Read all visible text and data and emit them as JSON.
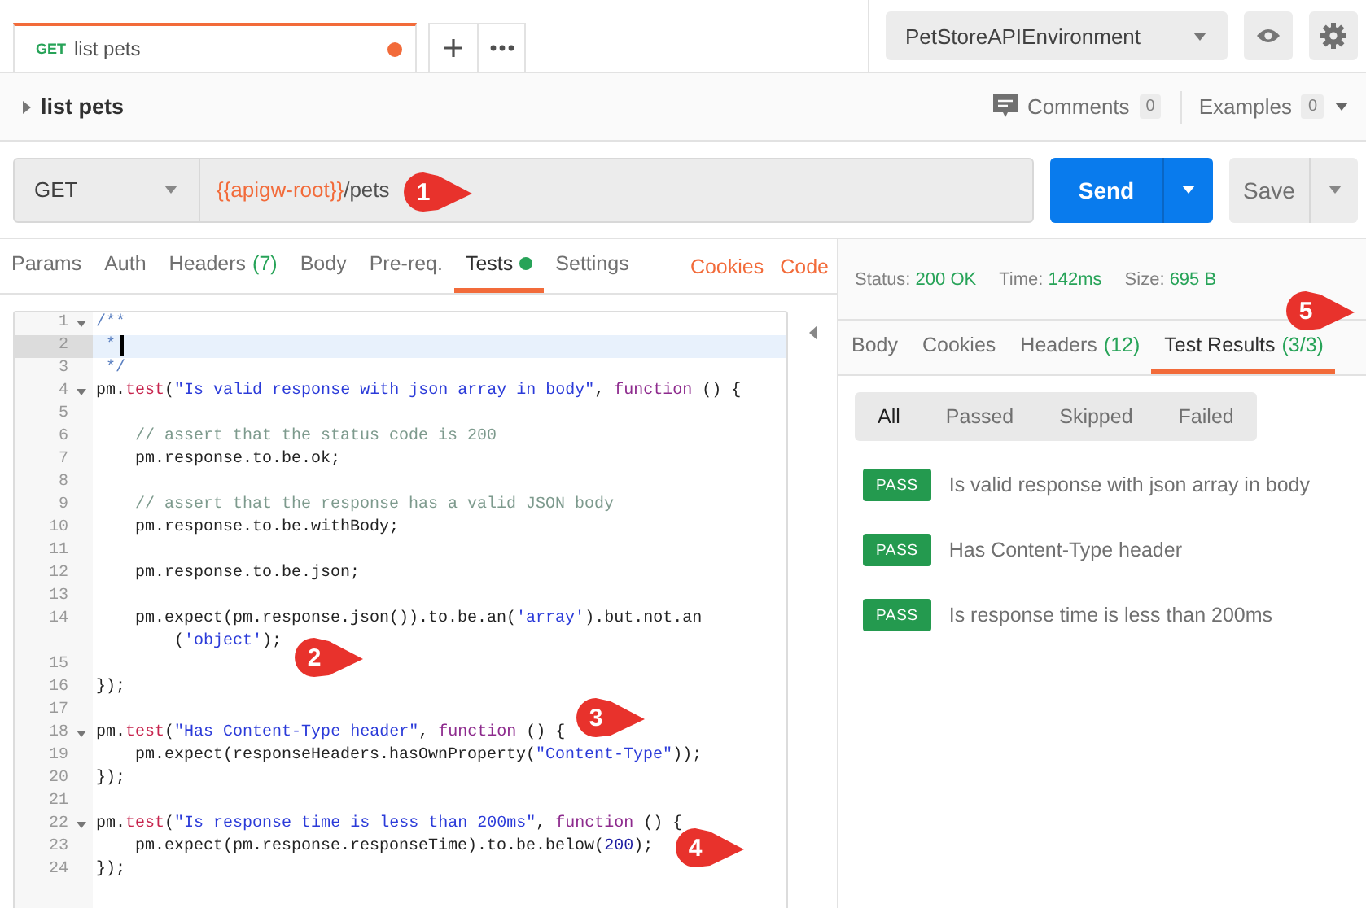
{
  "tab_bar": {
    "tabs": [
      {
        "method": "GET",
        "title": "list pets",
        "unsaved": true,
        "selected": true
      }
    ]
  },
  "environment": {
    "selected": "PetStoreAPIEnvironment"
  },
  "request_header": {
    "name": "list pets",
    "comments_label": "Comments",
    "comments_count": "0",
    "examples_label": "Examples",
    "examples_count": "0"
  },
  "url_bar": {
    "method": "GET",
    "url_variable": "{{apigw-root}}",
    "url_path": "/pets",
    "send": "Send",
    "save": "Save"
  },
  "request_tabs": [
    {
      "label": "Params",
      "selected": false,
      "dot": false
    },
    {
      "label": "Auth",
      "selected": false,
      "dot": false
    },
    {
      "label": "Headers",
      "count": "(7)",
      "selected": false,
      "dot": false
    },
    {
      "label": "Body",
      "selected": false,
      "dot": false
    },
    {
      "label": "Pre-req.",
      "selected": false,
      "dot": false
    },
    {
      "label": "Tests",
      "selected": true,
      "dot": true
    },
    {
      "label": "Settings",
      "selected": false,
      "dot": false
    }
  ],
  "request_links": [
    "Cookies",
    "Code"
  ],
  "editor": {
    "lines": [
      {
        "number": "1",
        "foldable": true,
        "active": false,
        "tokens": [
          {
            "kind": "doc",
            "text": "/**"
          }
        ]
      },
      {
        "number": "2",
        "foldable": false,
        "active": true,
        "tokens": [
          {
            "kind": "doc",
            "text": " *"
          }
        ]
      },
      {
        "number": "3",
        "foldable": false,
        "active": false,
        "tokens": [
          {
            "kind": "doc",
            "text": " */"
          }
        ]
      },
      {
        "number": "4",
        "foldable": true,
        "active": false,
        "tokens": [
          {
            "kind": "plain",
            "text": "pm."
          },
          {
            "kind": "method",
            "text": "test"
          },
          {
            "kind": "plain",
            "text": "("
          },
          {
            "kind": "string",
            "text": "\"Is valid response with json array in body\""
          },
          {
            "kind": "plain",
            "text": ", "
          },
          {
            "kind": "keyword",
            "text": "function"
          },
          {
            "kind": "plain",
            "text": " () {"
          }
        ]
      },
      {
        "number": "5",
        "foldable": false,
        "active": false
      },
      {
        "number": "6",
        "foldable": false,
        "active": false,
        "tokens": [
          {
            "kind": "comment",
            "text": "    // assert that the status code is 200"
          }
        ]
      },
      {
        "number": "7",
        "foldable": false,
        "active": false,
        "tokens": [
          {
            "kind": "plain",
            "text": "    pm.response.to.be.ok;"
          }
        ]
      },
      {
        "number": "8",
        "foldable": false,
        "active": false
      },
      {
        "number": "9",
        "foldable": false,
        "active": false,
        "tokens": [
          {
            "kind": "comment",
            "text": "    // assert that the response has a valid JSON body"
          }
        ]
      },
      {
        "number": "10",
        "foldable": false,
        "active": false,
        "tokens": [
          {
            "kind": "plain",
            "text": "    pm.response.to.be.withBody;"
          }
        ]
      },
      {
        "number": "11",
        "foldable": false,
        "active": false
      },
      {
        "number": "12",
        "foldable": false,
        "active": false,
        "tokens": [
          {
            "kind": "plain",
            "text": "    pm.response.to.be.json;"
          }
        ]
      },
      {
        "number": "13",
        "foldable": false,
        "active": false
      },
      {
        "number": "14",
        "foldable": false,
        "active": false,
        "tokens": [
          {
            "kind": "plain",
            "text": "    pm.expect(pm.response.json()).to.be.an("
          },
          {
            "kind": "string",
            "text": "'array'"
          },
          {
            "kind": "plain",
            "text": ").but.not.an"
          },
          {
            "kind": "wrap"
          },
          {
            "kind": "plain",
            "text": "("
          },
          {
            "kind": "string",
            "text": "'object'"
          },
          {
            "kind": "plain",
            "text": ");"
          }
        ]
      },
      {
        "number": "15",
        "foldable": false,
        "active": false
      },
      {
        "number": "16",
        "foldable": false,
        "active": false,
        "tokens": [
          {
            "kind": "plain",
            "text": "});"
          }
        ]
      },
      {
        "number": "17",
        "foldable": false,
        "active": false
      },
      {
        "number": "18",
        "foldable": true,
        "active": false,
        "tokens": [
          {
            "kind": "plain",
            "text": "pm."
          },
          {
            "kind": "method",
            "text": "test"
          },
          {
            "kind": "plain",
            "text": "("
          },
          {
            "kind": "string",
            "text": "\"Has Content-Type header\""
          },
          {
            "kind": "plain",
            "text": ", "
          },
          {
            "kind": "keyword",
            "text": "function"
          },
          {
            "kind": "plain",
            "text": " () {"
          }
        ]
      },
      {
        "number": "19",
        "foldable": false,
        "active": false,
        "tokens": [
          {
            "kind": "plain",
            "text": "    pm.expect(responseHeaders.hasOwnProperty("
          },
          {
            "kind": "string",
            "text": "\"Content-Type\""
          },
          {
            "kind": "plain",
            "text": "));"
          }
        ]
      },
      {
        "number": "20",
        "foldable": false,
        "active": false,
        "tokens": [
          {
            "kind": "plain",
            "text": "});"
          }
        ]
      },
      {
        "number": "21",
        "foldable": false,
        "active": false
      },
      {
        "number": "22",
        "foldable": true,
        "active": false,
        "tokens": [
          {
            "kind": "plain",
            "text": "pm."
          },
          {
            "kind": "method",
            "text": "test"
          },
          {
            "kind": "plain",
            "text": "("
          },
          {
            "kind": "string",
            "text": "\"Is response time is less than 200ms\""
          },
          {
            "kind": "plain",
            "text": ", "
          },
          {
            "kind": "keyword",
            "text": "function"
          },
          {
            "kind": "plain",
            "text": " () {"
          }
        ]
      },
      {
        "number": "23",
        "foldable": false,
        "active": false,
        "tokens": [
          {
            "kind": "plain",
            "text": "    pm.expect(pm.response.responseTime).to.be.below("
          },
          {
            "kind": "number",
            "text": "200"
          },
          {
            "kind": "plain",
            "text": ");"
          }
        ]
      },
      {
        "number": "24",
        "foldable": false,
        "active": false,
        "tokens": [
          {
            "kind": "plain",
            "text": "});"
          }
        ]
      }
    ]
  },
  "response": {
    "status_label": "Status:",
    "status": "200 OK",
    "time_label": "Time:",
    "time": "142ms",
    "size_label": "Size:",
    "size": "695 B",
    "tabs": [
      {
        "label": "Body",
        "selected": false
      },
      {
        "label": "Cookies",
        "selected": false
      },
      {
        "label": "Headers",
        "count": "(12)",
        "selected": false
      },
      {
        "label": "Test Results",
        "count": "(3/3)",
        "selected": true
      }
    ],
    "filters": [
      {
        "label": "All",
        "selected": true
      },
      {
        "label": "Passed",
        "selected": false
      },
      {
        "label": "Skipped",
        "selected": false
      },
      {
        "label": "Failed",
        "selected": false
      }
    ],
    "results": [
      {
        "result": "PASS",
        "name": "Is valid response with json array in body"
      },
      {
        "result": "PASS",
        "name": "Has Content-Type header"
      },
      {
        "result": "PASS",
        "name": "Is response time is less than 200ms"
      }
    ]
  },
  "callouts": [
    {
      "number": "1"
    },
    {
      "number": "2"
    },
    {
      "number": "3"
    },
    {
      "number": "4"
    },
    {
      "number": "5"
    }
  ]
}
